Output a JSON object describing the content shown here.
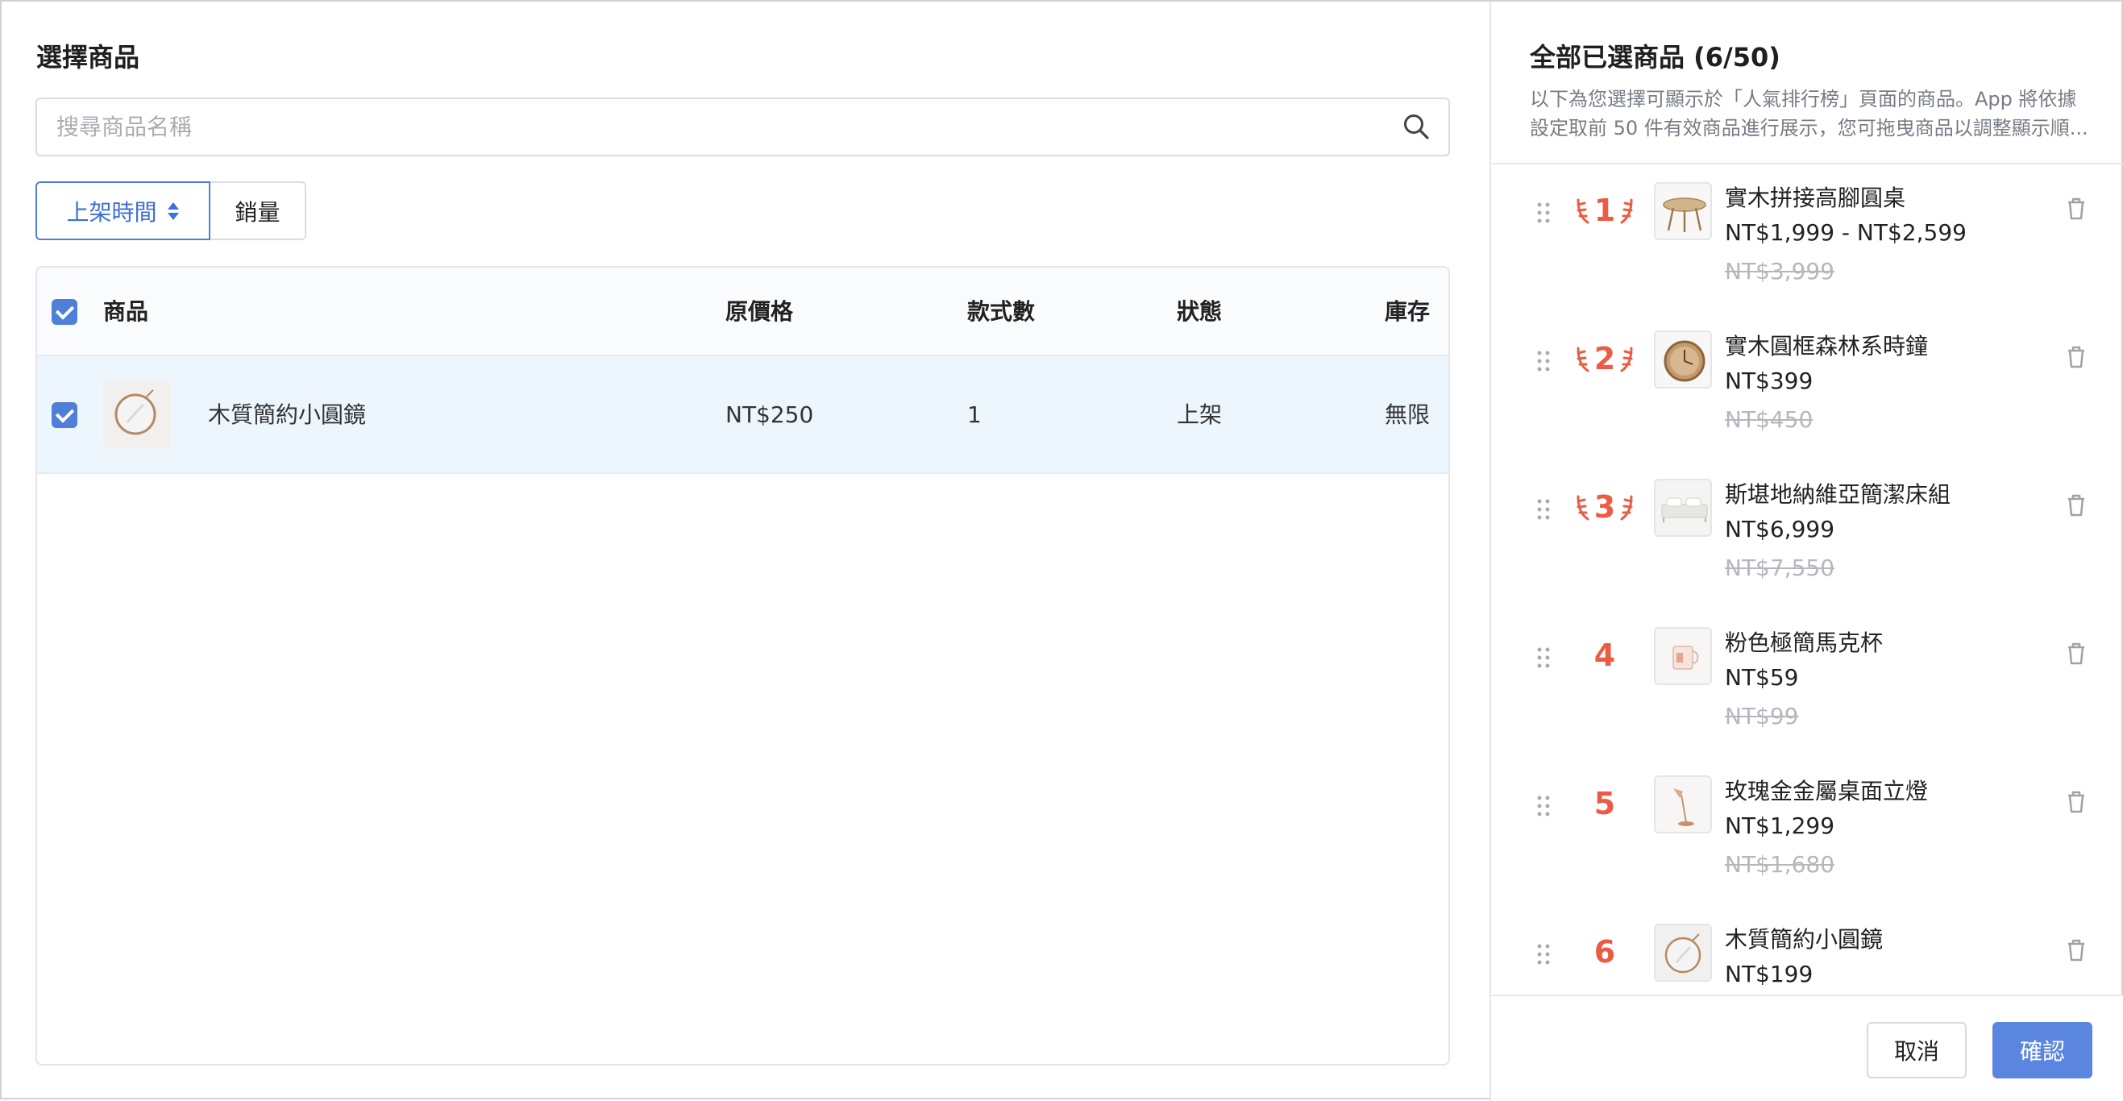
{
  "left_panel": {
    "title": "選擇商品",
    "search_placeholder": "搜尋商品名稱",
    "sort": {
      "active_label": "上架時間",
      "other_label": "銷量"
    },
    "table": {
      "headers": {
        "product": "商品",
        "original_price": "原價格",
        "variant_count": "款式數",
        "status": "狀態",
        "stock": "庫存"
      },
      "rows": [
        {
          "name": "木質簡約小圓鏡",
          "original_price": "NT$250",
          "variant_count": "1",
          "status": "上架",
          "stock": "無限",
          "checked": true
        }
      ]
    }
  },
  "right_panel": {
    "title": "全部已選商品 (6/50)",
    "description": "以下為您選擇可顯示於「人氣排行榜」頁面的商品。App 將依據設定取前 50 件有效商品進行展示，您可拖曳商品以調整顯示順...",
    "items": [
      {
        "rank": "1",
        "name": "實木拼接高腳圓桌",
        "price": "NT$1,999 - NT$2,599",
        "original_price": "NT$3,999"
      },
      {
        "rank": "2",
        "name": "實木圓框森林系時鐘",
        "price": "NT$399",
        "original_price": "NT$450"
      },
      {
        "rank": "3",
        "name": "斯堪地納維亞簡潔床組",
        "price": "NT$6,999",
        "original_price": "NT$7,550"
      },
      {
        "rank": "4",
        "name": "粉色極簡馬克杯",
        "price": "NT$59",
        "original_price": "NT$99"
      },
      {
        "rank": "5",
        "name": "玫瑰金金屬桌面立燈",
        "price": "NT$1,299",
        "original_price": "NT$1,680"
      },
      {
        "rank": "6",
        "name": "木質簡約小圓鏡",
        "price": "NT$199",
        "original_price": ""
      }
    ],
    "cancel_label": "取消",
    "confirm_label": "確認"
  },
  "colors": {
    "accent": "#4f7fd9",
    "primary_button": "#5b86e0",
    "rank": "#ec5c44",
    "selected_row": "#eef6fd"
  }
}
